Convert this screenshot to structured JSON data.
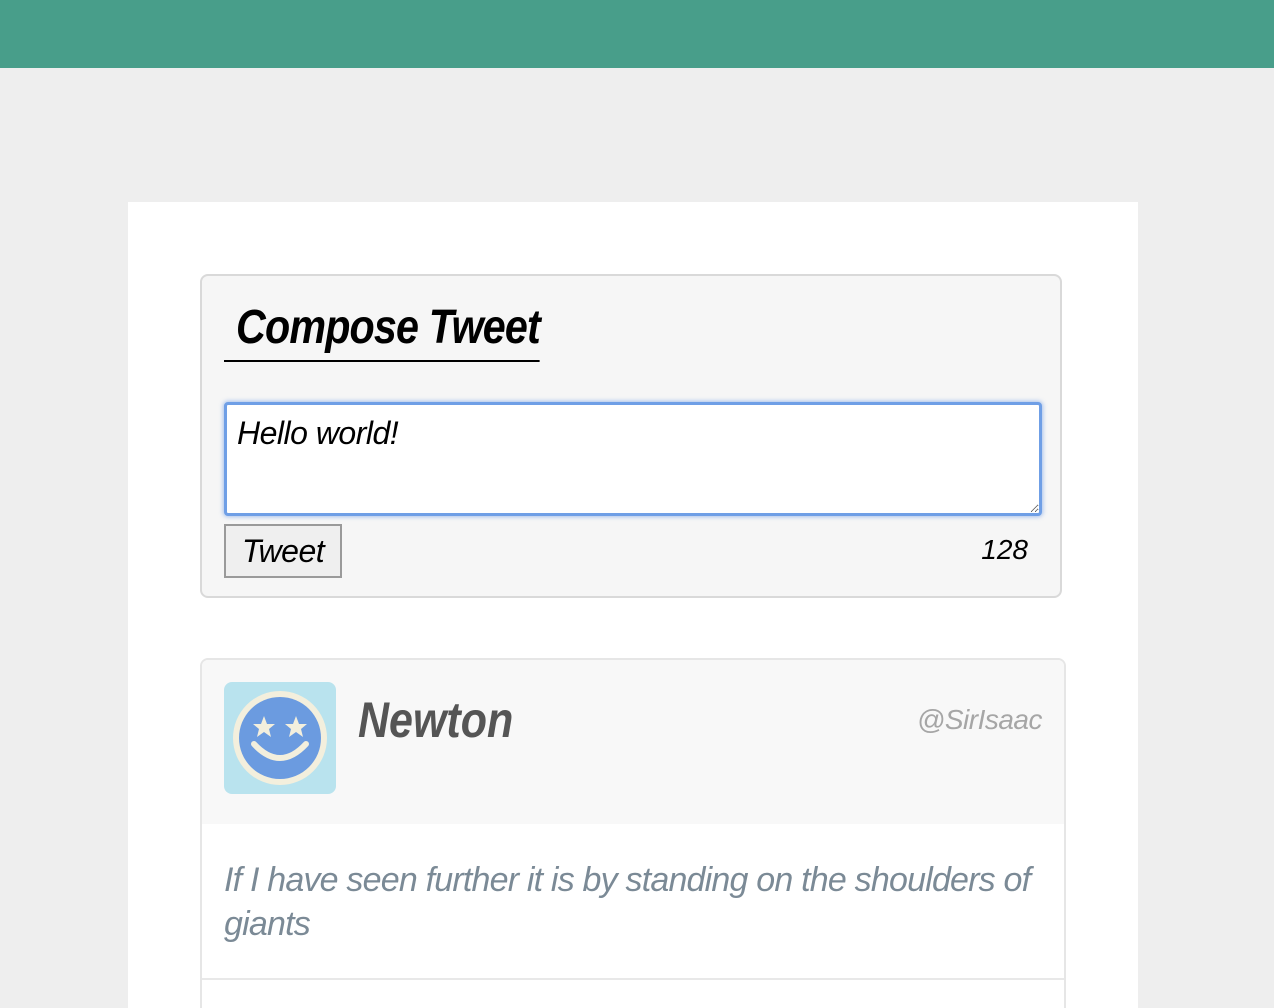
{
  "compose": {
    "title": "Compose Tweet",
    "input_value": "Hello world!",
    "button_label": "Tweet",
    "char_count": "128"
  },
  "tweet": {
    "name": "Newton",
    "handle": "@SirIsaac",
    "text": "If I have seen further it is by standing on the shoulders of giants",
    "avatar_icon": "smiley-star-eyes-icon"
  },
  "colors": {
    "header": "#489e8a",
    "page_background": "#eeeeee",
    "avatar_background": "#b9e3ee",
    "avatar_face": "#6b9be0",
    "focus_ring": "#6f9fe6"
  }
}
